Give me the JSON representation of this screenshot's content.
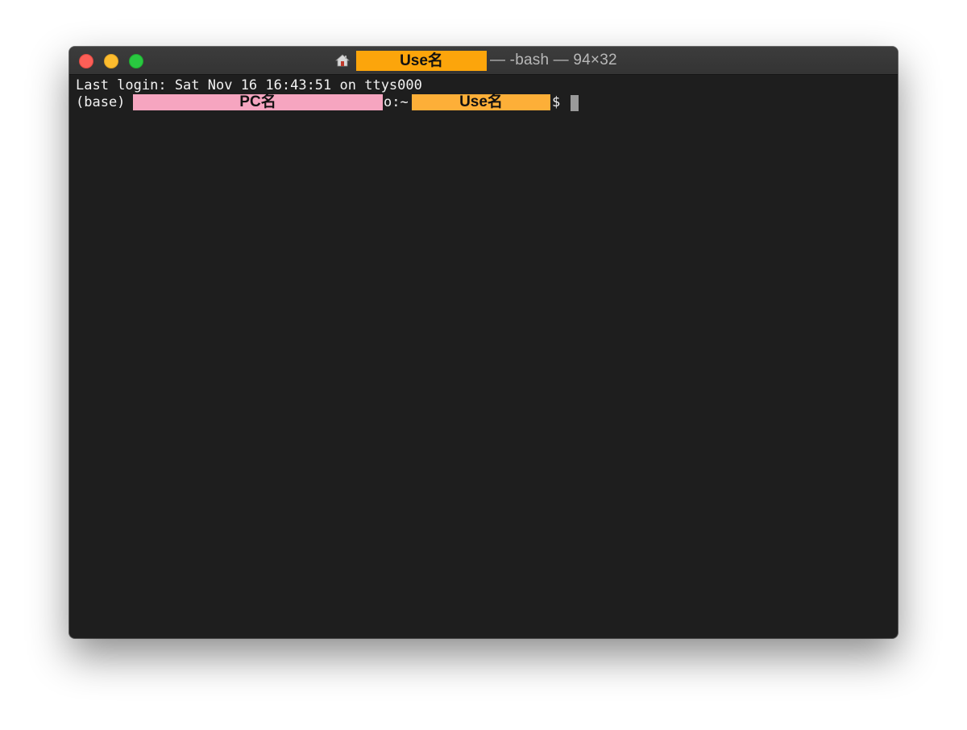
{
  "window": {
    "title_user": "Use名",
    "title_rest": "— -bash — 94×32",
    "title_icon": "home-folder-icon",
    "traffic_lights": {
      "close_color": "#fc5f57",
      "minimize_color": "#fdbc2e",
      "maximize_color": "#29c840"
    }
  },
  "terminal": {
    "line1": "Last login: Sat Nov 16 16:43:51 on ttys000",
    "prompt_env": "(base)",
    "pc_name_redaction": "PC名",
    "prompt_sep": "o:~",
    "user_name_redaction": "Use名",
    "prompt_symbol": "$",
    "background_color": "#1e1e1e",
    "text_color": "#f2f2f2",
    "redaction_colors": {
      "title_user": "#fca50b",
      "pc_name": "#f6a5c0",
      "user_name": "#fdaf38"
    }
  }
}
